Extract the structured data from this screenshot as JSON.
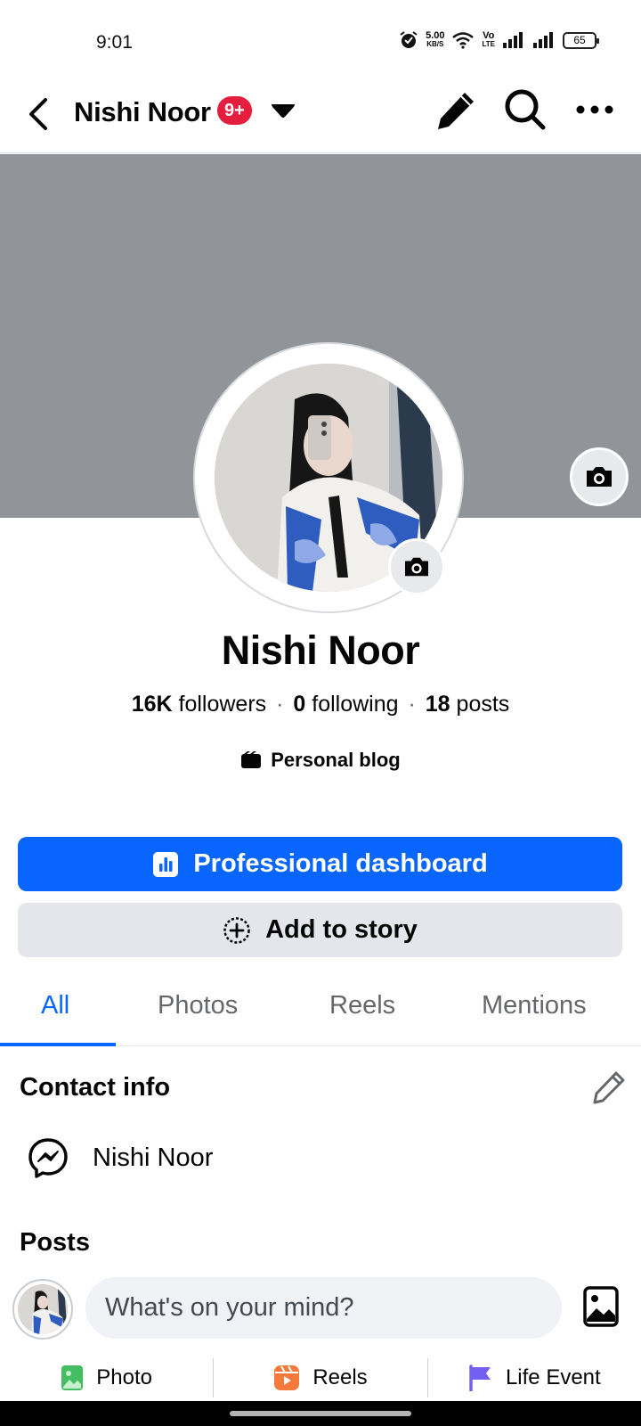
{
  "status_bar": {
    "time": "9:01",
    "net_speed_value": "5.00",
    "net_speed_unit": "KB/S",
    "volte_top": "Vo",
    "volte_bottom": "LTE",
    "battery": "65"
  },
  "header": {
    "title": "Nishi Noor",
    "notification_badge": "9+"
  },
  "profile": {
    "name": "Nishi Noor",
    "followers_count": "16K",
    "followers_label": "followers",
    "following_count": "0",
    "following_label": "following",
    "posts_count": "18",
    "posts_label": "posts",
    "separator": "·",
    "category": "Personal blog"
  },
  "actions": {
    "dashboard_label": "Professional dashboard",
    "add_story_label": "Add to story"
  },
  "tabs": [
    {
      "label": "All",
      "active": true
    },
    {
      "label": "Photos",
      "active": false
    },
    {
      "label": "Reels",
      "active": false
    },
    {
      "label": "Mentions",
      "active": false
    }
  ],
  "contact_info": {
    "title": "Contact info",
    "messenger_name": "Nishi Noor"
  },
  "posts": {
    "title": "Posts",
    "composer_placeholder": "What's on your mind?"
  },
  "quick_actions": [
    {
      "label": "Photo",
      "icon": "photo-icon",
      "color": "#45bd62"
    },
    {
      "label": "Reels",
      "icon": "reels-icon",
      "color": "#f5793b"
    },
    {
      "label": "Life Event",
      "icon": "flag-icon",
      "color": "#7360f2"
    }
  ],
  "colors": {
    "accent": "#0866ff",
    "cover": "#919599",
    "badge": "#e41e3f",
    "secondary_button": "#e4e6eb"
  }
}
